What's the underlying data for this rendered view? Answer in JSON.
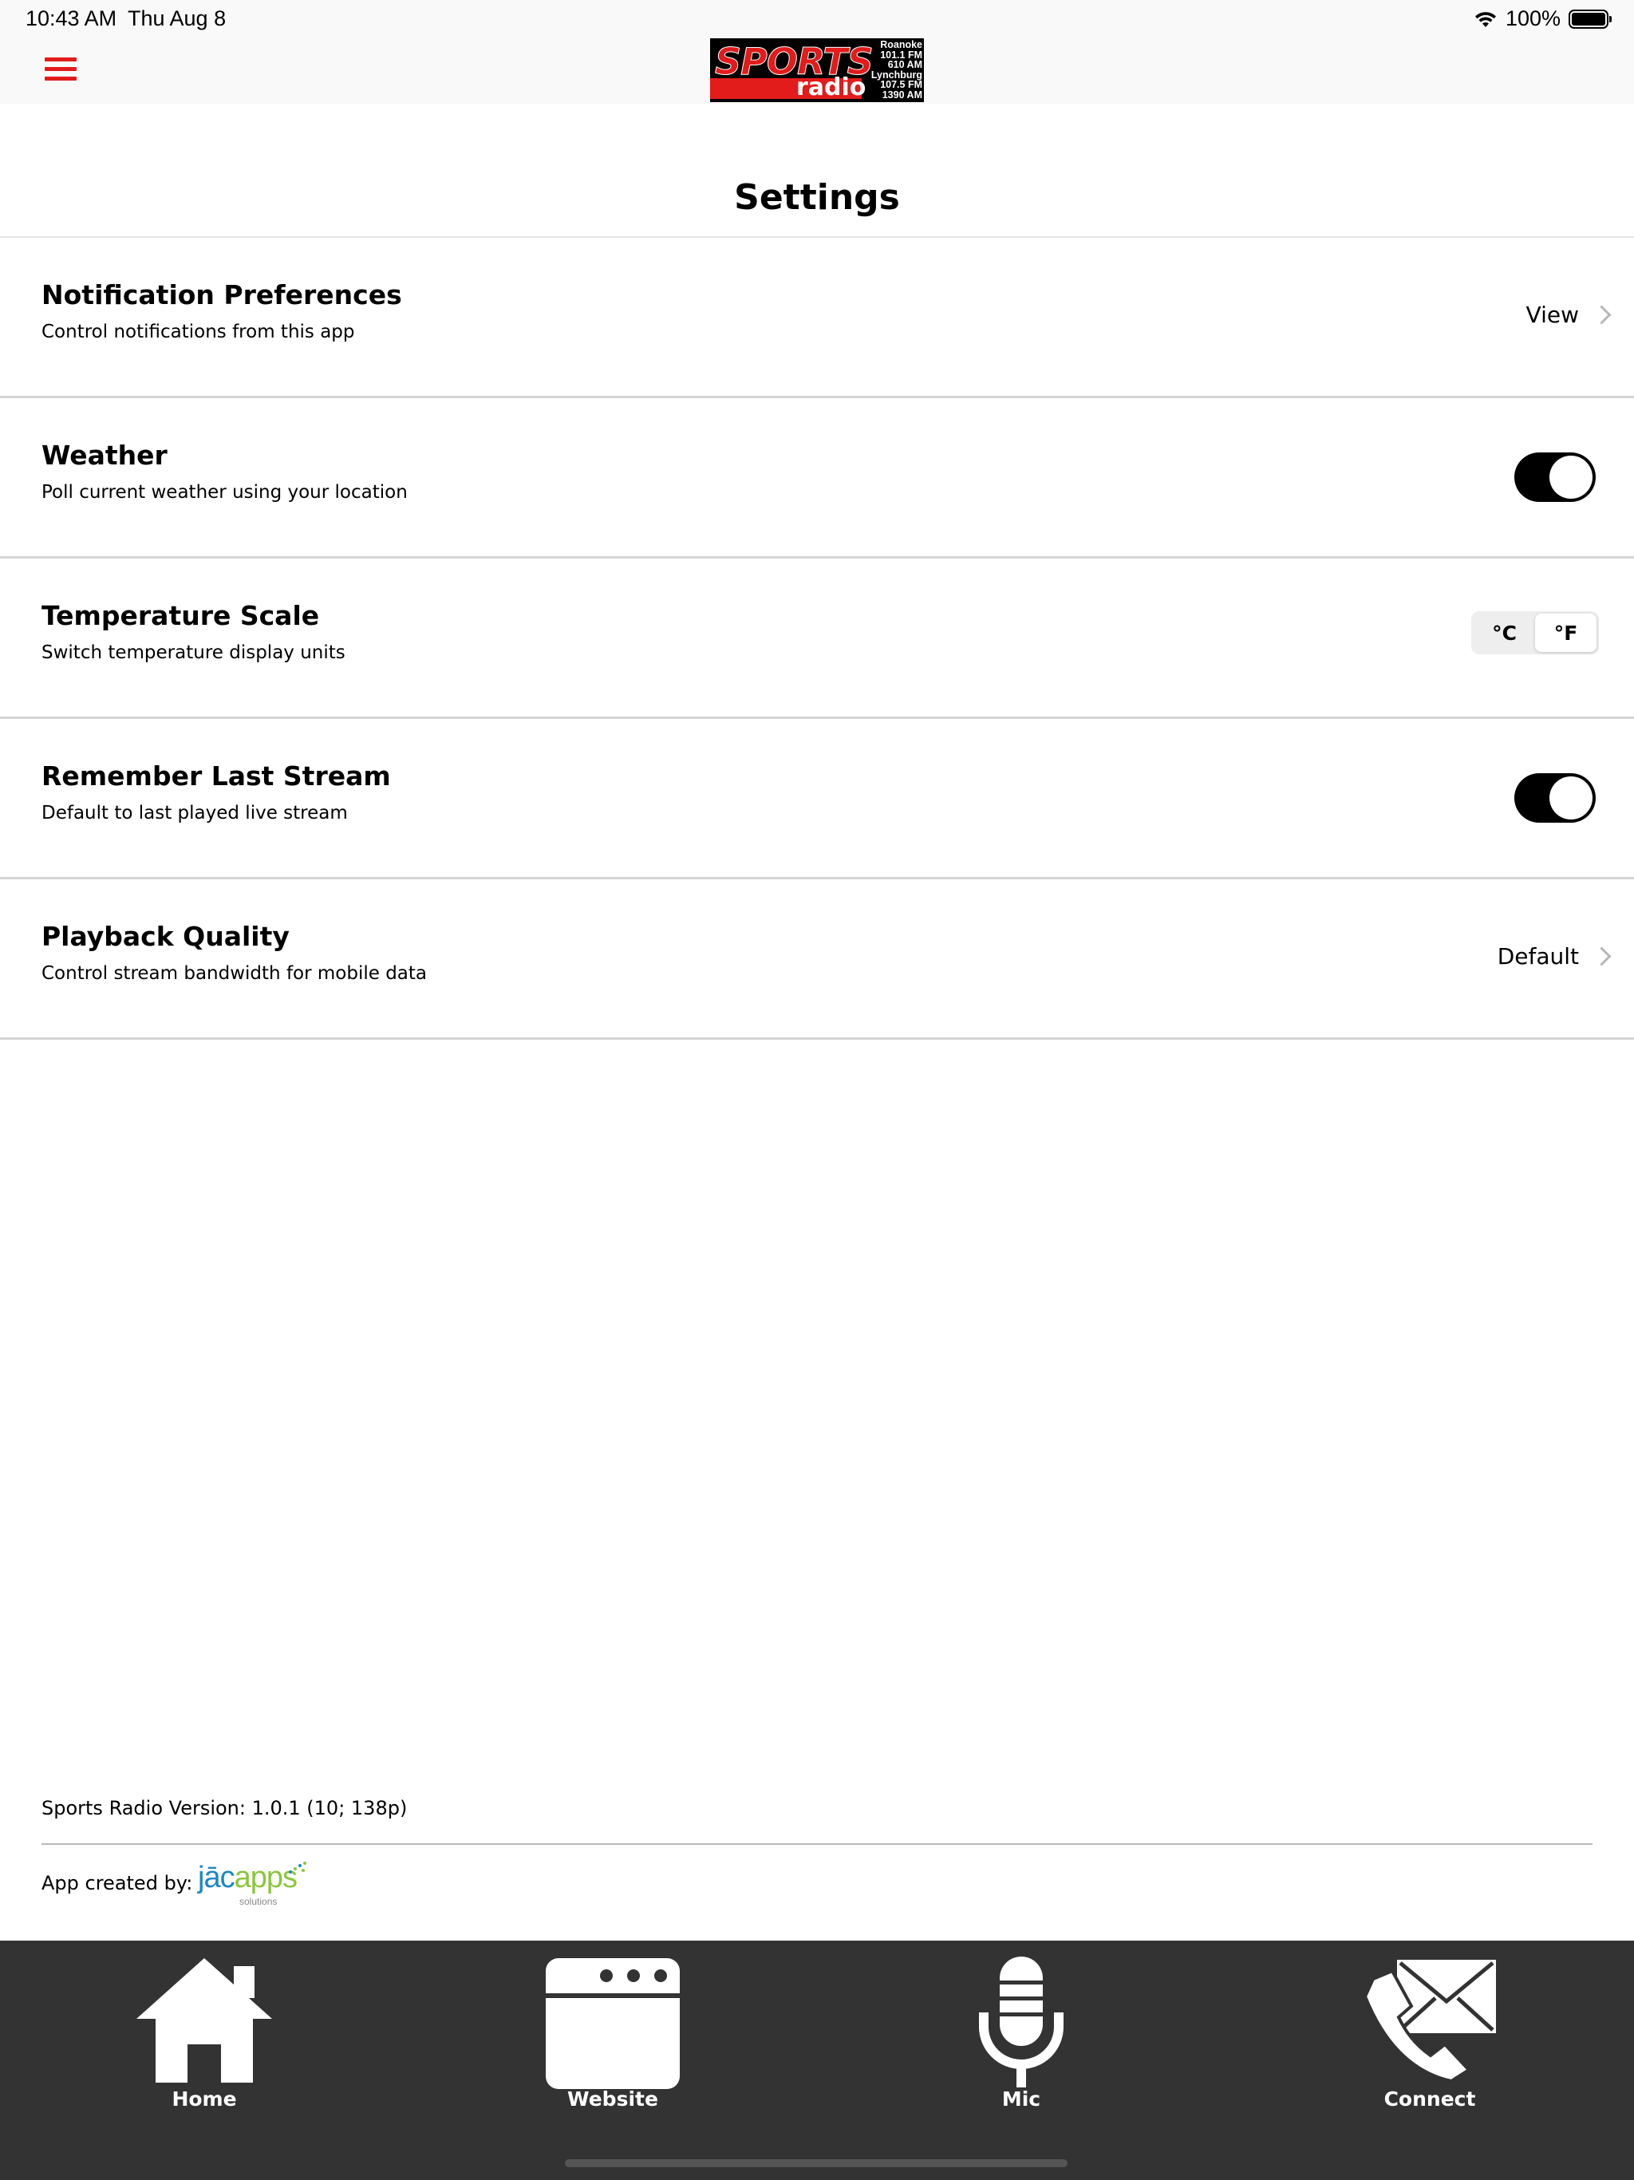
{
  "status_bar": {
    "time": "10:43 AM",
    "date": "Thu Aug 8",
    "battery": "100%"
  },
  "nav": {
    "menu_icon": "hamburger-menu-icon",
    "logo": {
      "word1": "SPORTS",
      "word2": "radio",
      "lines": [
        "Roanoke",
        "101.1 FM",
        "610 AM",
        "Lynchburg",
        "107.5 FM",
        "1390 AM"
      ]
    }
  },
  "page": {
    "title": "Settings"
  },
  "settings": [
    {
      "title": "Notification Preferences",
      "subtitle": "Control notifications from this app",
      "action": "View"
    },
    {
      "title": "Weather",
      "subtitle": "Poll current weather using your location",
      "toggle_on": true
    },
    {
      "title": "Temperature Scale",
      "subtitle": "Switch temperature display units",
      "options": [
        "°C",
        "°F"
      ],
      "selected": "°F"
    },
    {
      "title": "Remember Last Stream",
      "subtitle": "Default to last played live stream",
      "toggle_on": true
    },
    {
      "title": "Playback Quality",
      "subtitle": "Control stream bandwidth for mobile data",
      "action": "Default"
    }
  ],
  "footer": {
    "version": "Sports Radio Version: 1.0.1 (10; 138p)",
    "created_by": "App created by:",
    "jacapps": {
      "jac": "jāc",
      "apps": "apps",
      "sub": "solutions"
    }
  },
  "tabs": [
    {
      "label": "Home",
      "icon": "home-icon"
    },
    {
      "label": "Website",
      "icon": "browser-window-icon"
    },
    {
      "label": "Mic",
      "icon": "microphone-icon"
    },
    {
      "label": "Connect",
      "icon": "phone-envelope-icon"
    }
  ],
  "colors": {
    "accent": "#e21b1b",
    "tab_bar": "#333333",
    "toggle_on": "#000000"
  }
}
